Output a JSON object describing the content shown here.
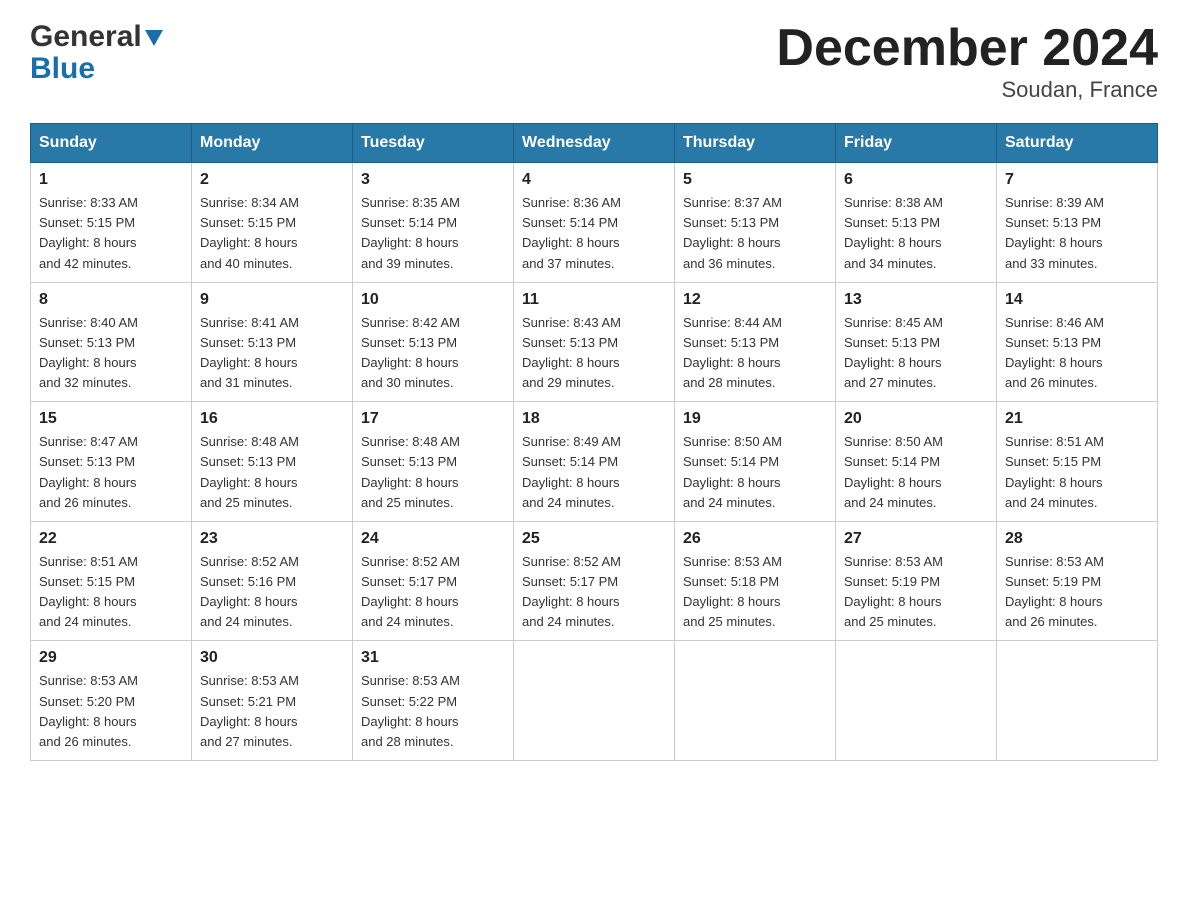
{
  "header": {
    "logo_general": "General",
    "logo_blue": "Blue",
    "month_title": "December 2024",
    "location": "Soudan, France"
  },
  "days_of_week": [
    "Sunday",
    "Monday",
    "Tuesday",
    "Wednesday",
    "Thursday",
    "Friday",
    "Saturday"
  ],
  "weeks": [
    [
      {
        "day": "1",
        "sunrise": "Sunrise: 8:33 AM",
        "sunset": "Sunset: 5:15 PM",
        "daylight": "Daylight: 8 hours",
        "daylight2": "and 42 minutes."
      },
      {
        "day": "2",
        "sunrise": "Sunrise: 8:34 AM",
        "sunset": "Sunset: 5:15 PM",
        "daylight": "Daylight: 8 hours",
        "daylight2": "and 40 minutes."
      },
      {
        "day": "3",
        "sunrise": "Sunrise: 8:35 AM",
        "sunset": "Sunset: 5:14 PM",
        "daylight": "Daylight: 8 hours",
        "daylight2": "and 39 minutes."
      },
      {
        "day": "4",
        "sunrise": "Sunrise: 8:36 AM",
        "sunset": "Sunset: 5:14 PM",
        "daylight": "Daylight: 8 hours",
        "daylight2": "and 37 minutes."
      },
      {
        "day": "5",
        "sunrise": "Sunrise: 8:37 AM",
        "sunset": "Sunset: 5:13 PM",
        "daylight": "Daylight: 8 hours",
        "daylight2": "and 36 minutes."
      },
      {
        "day": "6",
        "sunrise": "Sunrise: 8:38 AM",
        "sunset": "Sunset: 5:13 PM",
        "daylight": "Daylight: 8 hours",
        "daylight2": "and 34 minutes."
      },
      {
        "day": "7",
        "sunrise": "Sunrise: 8:39 AM",
        "sunset": "Sunset: 5:13 PM",
        "daylight": "Daylight: 8 hours",
        "daylight2": "and 33 minutes."
      }
    ],
    [
      {
        "day": "8",
        "sunrise": "Sunrise: 8:40 AM",
        "sunset": "Sunset: 5:13 PM",
        "daylight": "Daylight: 8 hours",
        "daylight2": "and 32 minutes."
      },
      {
        "day": "9",
        "sunrise": "Sunrise: 8:41 AM",
        "sunset": "Sunset: 5:13 PM",
        "daylight": "Daylight: 8 hours",
        "daylight2": "and 31 minutes."
      },
      {
        "day": "10",
        "sunrise": "Sunrise: 8:42 AM",
        "sunset": "Sunset: 5:13 PM",
        "daylight": "Daylight: 8 hours",
        "daylight2": "and 30 minutes."
      },
      {
        "day": "11",
        "sunrise": "Sunrise: 8:43 AM",
        "sunset": "Sunset: 5:13 PM",
        "daylight": "Daylight: 8 hours",
        "daylight2": "and 29 minutes."
      },
      {
        "day": "12",
        "sunrise": "Sunrise: 8:44 AM",
        "sunset": "Sunset: 5:13 PM",
        "daylight": "Daylight: 8 hours",
        "daylight2": "and 28 minutes."
      },
      {
        "day": "13",
        "sunrise": "Sunrise: 8:45 AM",
        "sunset": "Sunset: 5:13 PM",
        "daylight": "Daylight: 8 hours",
        "daylight2": "and 27 minutes."
      },
      {
        "day": "14",
        "sunrise": "Sunrise: 8:46 AM",
        "sunset": "Sunset: 5:13 PM",
        "daylight": "Daylight: 8 hours",
        "daylight2": "and 26 minutes."
      }
    ],
    [
      {
        "day": "15",
        "sunrise": "Sunrise: 8:47 AM",
        "sunset": "Sunset: 5:13 PM",
        "daylight": "Daylight: 8 hours",
        "daylight2": "and 26 minutes."
      },
      {
        "day": "16",
        "sunrise": "Sunrise: 8:48 AM",
        "sunset": "Sunset: 5:13 PM",
        "daylight": "Daylight: 8 hours",
        "daylight2": "and 25 minutes."
      },
      {
        "day": "17",
        "sunrise": "Sunrise: 8:48 AM",
        "sunset": "Sunset: 5:13 PM",
        "daylight": "Daylight: 8 hours",
        "daylight2": "and 25 minutes."
      },
      {
        "day": "18",
        "sunrise": "Sunrise: 8:49 AM",
        "sunset": "Sunset: 5:14 PM",
        "daylight": "Daylight: 8 hours",
        "daylight2": "and 24 minutes."
      },
      {
        "day": "19",
        "sunrise": "Sunrise: 8:50 AM",
        "sunset": "Sunset: 5:14 PM",
        "daylight": "Daylight: 8 hours",
        "daylight2": "and 24 minutes."
      },
      {
        "day": "20",
        "sunrise": "Sunrise: 8:50 AM",
        "sunset": "Sunset: 5:14 PM",
        "daylight": "Daylight: 8 hours",
        "daylight2": "and 24 minutes."
      },
      {
        "day": "21",
        "sunrise": "Sunrise: 8:51 AM",
        "sunset": "Sunset: 5:15 PM",
        "daylight": "Daylight: 8 hours",
        "daylight2": "and 24 minutes."
      }
    ],
    [
      {
        "day": "22",
        "sunrise": "Sunrise: 8:51 AM",
        "sunset": "Sunset: 5:15 PM",
        "daylight": "Daylight: 8 hours",
        "daylight2": "and 24 minutes."
      },
      {
        "day": "23",
        "sunrise": "Sunrise: 8:52 AM",
        "sunset": "Sunset: 5:16 PM",
        "daylight": "Daylight: 8 hours",
        "daylight2": "and 24 minutes."
      },
      {
        "day": "24",
        "sunrise": "Sunrise: 8:52 AM",
        "sunset": "Sunset: 5:17 PM",
        "daylight": "Daylight: 8 hours",
        "daylight2": "and 24 minutes."
      },
      {
        "day": "25",
        "sunrise": "Sunrise: 8:52 AM",
        "sunset": "Sunset: 5:17 PM",
        "daylight": "Daylight: 8 hours",
        "daylight2": "and 24 minutes."
      },
      {
        "day": "26",
        "sunrise": "Sunrise: 8:53 AM",
        "sunset": "Sunset: 5:18 PM",
        "daylight": "Daylight: 8 hours",
        "daylight2": "and 25 minutes."
      },
      {
        "day": "27",
        "sunrise": "Sunrise: 8:53 AM",
        "sunset": "Sunset: 5:19 PM",
        "daylight": "Daylight: 8 hours",
        "daylight2": "and 25 minutes."
      },
      {
        "day": "28",
        "sunrise": "Sunrise: 8:53 AM",
        "sunset": "Sunset: 5:19 PM",
        "daylight": "Daylight: 8 hours",
        "daylight2": "and 26 minutes."
      }
    ],
    [
      {
        "day": "29",
        "sunrise": "Sunrise: 8:53 AM",
        "sunset": "Sunset: 5:20 PM",
        "daylight": "Daylight: 8 hours",
        "daylight2": "and 26 minutes."
      },
      {
        "day": "30",
        "sunrise": "Sunrise: 8:53 AM",
        "sunset": "Sunset: 5:21 PM",
        "daylight": "Daylight: 8 hours",
        "daylight2": "and 27 minutes."
      },
      {
        "day": "31",
        "sunrise": "Sunrise: 8:53 AM",
        "sunset": "Sunset: 5:22 PM",
        "daylight": "Daylight: 8 hours",
        "daylight2": "and 28 minutes."
      },
      null,
      null,
      null,
      null
    ]
  ]
}
